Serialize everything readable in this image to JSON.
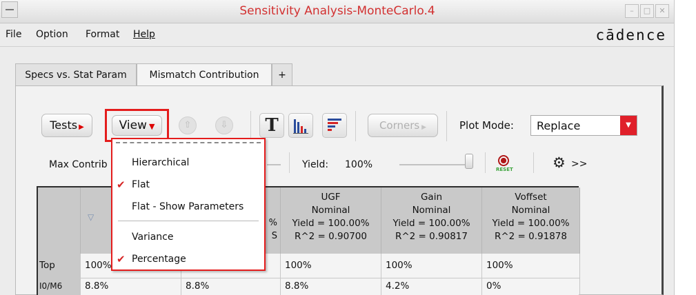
{
  "window": {
    "title": "Sensitivity Analysis-MonteCarlo.4",
    "logo": "cādence"
  },
  "menu": [
    "File",
    "Option",
    "Format",
    "Help"
  ],
  "tabs": [
    "Specs vs. Stat Param",
    "Mismatch Contribution",
    "+"
  ],
  "toolbar": {
    "tests_label": "Tests",
    "view_label": "View",
    "text_view_glyph": "T",
    "corners_label": "Corners",
    "plot_mode_label": "Plot Mode:",
    "plot_mode_value": "Replace"
  },
  "filters": {
    "max_contrib_label": "Max Contrib",
    "yield_label": "Yield:",
    "yield_value": "100%",
    "more_label": ">>"
  },
  "view_menu": {
    "items": [
      {
        "label": "Hierarchical",
        "checked": false
      },
      {
        "label": "Flat",
        "checked": true
      },
      {
        "label": "Flat - Show Parameters",
        "checked": false
      },
      {
        "label": "Variance",
        "checked": false
      },
      {
        "label": "Percentage",
        "checked": true
      }
    ],
    "check_glyph": "✔"
  },
  "table": {
    "sort_glyph": "▽",
    "partial_col": {
      "pct": "%",
      "s": "S"
    },
    "columns": [
      {
        "name": "UGF",
        "sub": "Nominal",
        "yield": "Yield = 100.00%",
        "r2": "R^2 = 0.90700"
      },
      {
        "name": "Gain",
        "sub": "Nominal",
        "yield": "Yield = 100.00%",
        "r2": "R^2 = 0.90817"
      },
      {
        "name": "Voffset",
        "sub": "Nominal",
        "yield": "Yield = 100.00%",
        "r2": "R^2 = 0.91878"
      }
    ],
    "rows": [
      {
        "name": "Top",
        "c1": "100%",
        "c3": "100%",
        "c4": "100%",
        "c5": "100%"
      },
      {
        "name": "I0/M6",
        "c1": "8.8%",
        "c2": "8.8%",
        "c3": "8.8%",
        "c4": "4.2%",
        "c5": "0%"
      }
    ]
  }
}
